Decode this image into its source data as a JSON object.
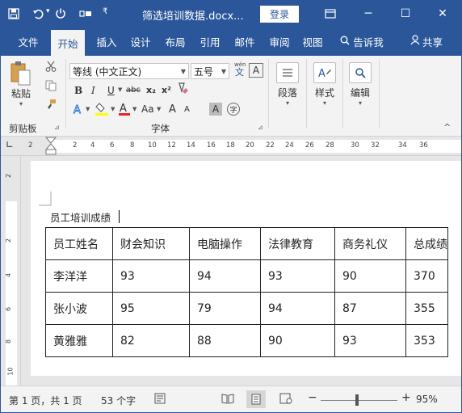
{
  "titlebar": {
    "save_icon": "save-icon",
    "undo_icon": "undo-icon",
    "redo_icon": "redo-icon",
    "layout_icon": "touch-mode-icon",
    "customize_icon": "customize-qat-icon",
    "doc_title": "筛选培训数据.docx...",
    "login": "登录",
    "ribbon_display_icon": "ribbon-display-icon",
    "minimize": "─",
    "maximize": "☐",
    "close": "✕"
  },
  "tabs": [
    {
      "label": "文件"
    },
    {
      "label": "开始"
    },
    {
      "label": "插入"
    },
    {
      "label": "设计"
    },
    {
      "label": "布局"
    },
    {
      "label": "引用"
    },
    {
      "label": "邮件"
    },
    {
      "label": "审阅"
    },
    {
      "label": "视图"
    },
    {
      "label": "告诉我"
    },
    {
      "label": "共享"
    }
  ],
  "ribbon": {
    "clipboard": {
      "paste": "粘贴",
      "label": "剪贴板"
    },
    "font": {
      "name": "等线 (中文正文)",
      "size": "五号",
      "bold": "B",
      "italic": "I",
      "underline": "U",
      "strike": "abc",
      "sub": "x₂",
      "sup": "x²",
      "aa": "Aa",
      "grow": "A",
      "shrink": "A",
      "label": "字体"
    },
    "paragraph": {
      "label": "段落"
    },
    "styles": {
      "label": "样式"
    },
    "editing": {
      "label": "编辑"
    }
  },
  "ruler": {
    "h_marks": [
      "2",
      "2",
      "4",
      "6",
      "8",
      "10",
      "12",
      "14",
      "16",
      "18",
      "20",
      "22",
      "24",
      "26",
      "28",
      "30",
      "32",
      "34",
      "36"
    ],
    "v_marks": [
      "2",
      "2",
      "4",
      "6",
      "8",
      "10"
    ]
  },
  "document": {
    "caption": "员工培训成绩",
    "table": {
      "header": [
        "员工姓名",
        "财会知识",
        "电脑操作",
        "法律教育",
        "商务礼仪",
        "总成绩"
      ],
      "rows": [
        [
          "李洋洋",
          "93",
          "94",
          "93",
          "90",
          "370"
        ],
        [
          "张小波",
          "95",
          "79",
          "94",
          "87",
          "355"
        ],
        [
          "黄雅雅",
          "82",
          "88",
          "90",
          "93",
          "353"
        ]
      ]
    }
  },
  "status": {
    "page": "第 1 页，共 1 页",
    "words": "53 个字",
    "zoom": "95%",
    "zoom_level": 0.95
  }
}
